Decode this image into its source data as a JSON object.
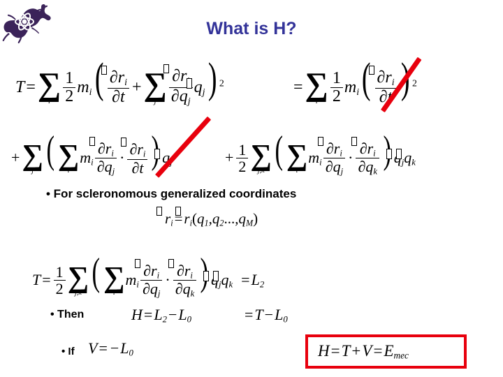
{
  "slide": {
    "title": "What is H?",
    "title_color": "#333399",
    "accent_red": "#e8000d",
    "logo_color": "#3b2359",
    "logo_name": "gecko-atom-logo"
  },
  "equations": {
    "kinetic_energy": {
      "lhs": "T",
      "eq": "=",
      "line1": {
        "sum_symbol": "∑",
        "sum_index": "i",
        "half_num": "1",
        "half_den": "2",
        "mass": "m",
        "mass_sub": "i",
        "term1_num": "∂r",
        "term1_num_sub": "i",
        "term1_den": "∂t",
        "plus": "+",
        "sum2_index": "j",
        "term2_num": "∂r",
        "term2_num_sub": "i",
        "term2_den": "∂q",
        "term2_den_sub": "j",
        "qdot": "q",
        "qdot_sub": "j",
        "power": "2"
      },
      "rhs": {
        "eq": "=",
        "sum_index": "i",
        "half_num": "1",
        "half_den": "2",
        "mass": "m",
        "mass_sub": "i",
        "num": "∂r",
        "num_sub": "i",
        "den": "∂t",
        "power": "2"
      },
      "line2": {
        "plus": "+",
        "sum_outer_index": "j",
        "sum_inner_index": "i",
        "mass": "m",
        "mass_sub": "i",
        "f1_num": "∂r",
        "f1_num_sub": "i",
        "f1_den": "∂q",
        "f1_den_sub": "j",
        "dot": "·",
        "f2_num": "∂r",
        "f2_num_sub": "i",
        "f2_den": "∂t",
        "qdot": "q",
        "qdot_sub": "j"
      },
      "line3": {
        "plus": "+",
        "half_num": "1",
        "half_den": "2",
        "sum_outer_index": "j,k",
        "sum_inner_index": "i",
        "mass": "m",
        "mass_sub": "i",
        "f1_num": "∂r",
        "f1_num_sub": "i",
        "f1_den": "∂q",
        "f1_den_sub": "j",
        "dot": "·",
        "f2_num": "∂r",
        "f2_num_sub": "i",
        "f2_den": "∂q",
        "f2_den_sub": "k",
        "qdot1": "q",
        "qdot1_sub": "j",
        "qdot2": "q",
        "qdot2_sub": "k"
      }
    },
    "position_vector": {
      "lhs": "r",
      "lhs_sub": "i",
      "eq": "=",
      "rhs": "r",
      "rhs_sub": "i",
      "open": "(",
      "q1": "q",
      "q1_sub": "1",
      "comma1": ",",
      "q2": "q",
      "q2_sub": "2",
      "comma2": ",",
      "ellipsis": "...,",
      "qM": "q",
      "qM_sub": "M",
      "close": ")"
    },
    "kinetic_scleronomous": {
      "lhs": "T",
      "eq": "=",
      "half_num": "1",
      "half_den": "2",
      "sum_outer_index": "j,k",
      "sum_inner_index": "i",
      "mass": "m",
      "mass_sub": "i",
      "f1_num": "∂r",
      "f1_num_sub": "i",
      "f1_den": "∂q",
      "f1_den_sub": "j",
      "dot": "·",
      "f2_num": "∂r",
      "f2_num_sub": "i",
      "f2_den": "∂q",
      "f2_den_sub": "k",
      "qdot1": "q",
      "qdot1_sub": "j",
      "qdot2": "q",
      "qdot2_sub": "k",
      "eq2": "=",
      "result": "L",
      "result_sub": "2"
    },
    "hamiltonian_then": {
      "H": "H",
      "eq1": "=",
      "L2": "L",
      "L2_sub": "2",
      "minus": "−",
      "L0": "L",
      "L0_sub": "0",
      "eq2": "=",
      "T": "T",
      "minus2": "−",
      "L0b": "L",
      "L0b_sub": "0"
    },
    "potential_if": {
      "V": "V",
      "eq": "=",
      "minus": "−",
      "L0": "L",
      "L0_sub": "0"
    },
    "boxed_result": {
      "H": "H",
      "eq1": "=",
      "T": "T",
      "plus": "+",
      "V": "V",
      "eq2": "=",
      "E": "E",
      "E_sub": "mec"
    }
  },
  "bullets": {
    "scleronomous": "• For scleronomous generalized coordinates",
    "then": "• Then",
    "if": "• If"
  }
}
